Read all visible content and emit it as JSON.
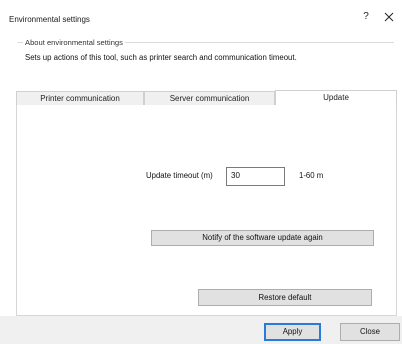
{
  "window": {
    "title": "Environmental settings",
    "help_glyph": "?",
    "close_icon": "close-icon"
  },
  "about": {
    "legend": "About environmental settings",
    "description": "Sets up actions of this tool, such as printer search and communication timeout."
  },
  "tabs": [
    {
      "label": "Printer communication",
      "active": false
    },
    {
      "label": "Server communication",
      "active": false
    },
    {
      "label": "Update",
      "active": true
    }
  ],
  "update": {
    "timeout_label": "Update timeout (m)",
    "timeout_value": "30",
    "range_label": "1-60 m",
    "notify_button": "Notify of the software update again",
    "restore_button": "Restore default"
  },
  "footer": {
    "apply_button": "Apply",
    "close_button": "Close"
  },
  "colors": {
    "accent": "#2b79d8",
    "button_face": "#e1e1e1",
    "footer_bg": "#f0f0f0"
  }
}
